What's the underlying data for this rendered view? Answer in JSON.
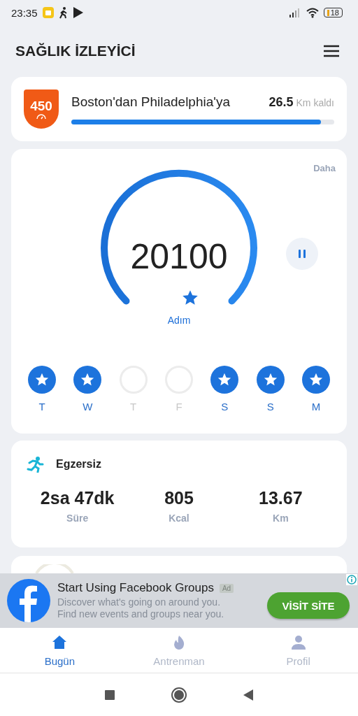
{
  "status_bar": {
    "time": "23:35",
    "battery": "18"
  },
  "header": {
    "title": "SAĞLIK İZLEYİCİ"
  },
  "challenge": {
    "badge": "450",
    "title": "Boston'dan Philadelphia'ya",
    "distance": "26.5",
    "unit": "Km kaldı",
    "level": 0.95
  },
  "steps": {
    "more": "Daha",
    "count": "20100",
    "label": "Adım",
    "days": [
      {
        "label": "T",
        "done": true
      },
      {
        "label": "W",
        "done": true
      },
      {
        "label": "T",
        "done": false
      },
      {
        "label": "F",
        "done": false
      },
      {
        "label": "S",
        "done": true
      },
      {
        "label": "S",
        "done": true
      },
      {
        "label": "M",
        "done": true
      }
    ]
  },
  "exercise": {
    "title": "Egzersiz",
    "stats": [
      {
        "value": "2sa 47dk",
        "label": "Süre"
      },
      {
        "value": "805",
        "label": "Kcal"
      },
      {
        "value": "13.67",
        "label": "Km"
      }
    ]
  },
  "ad": {
    "title": "Start Using Facebook Groups",
    "badge": "Ad",
    "text": "Discover what's going on around you. Find new events and groups near you.",
    "button": "VİSİT SİTE"
  },
  "bottom_nav": [
    {
      "kind": "home",
      "label": "Bugün",
      "selected": true
    },
    {
      "kind": "fire",
      "label": "Antrenman",
      "selected": false
    },
    {
      "kind": "person",
      "label": "Profil",
      "selected": false
    }
  ]
}
